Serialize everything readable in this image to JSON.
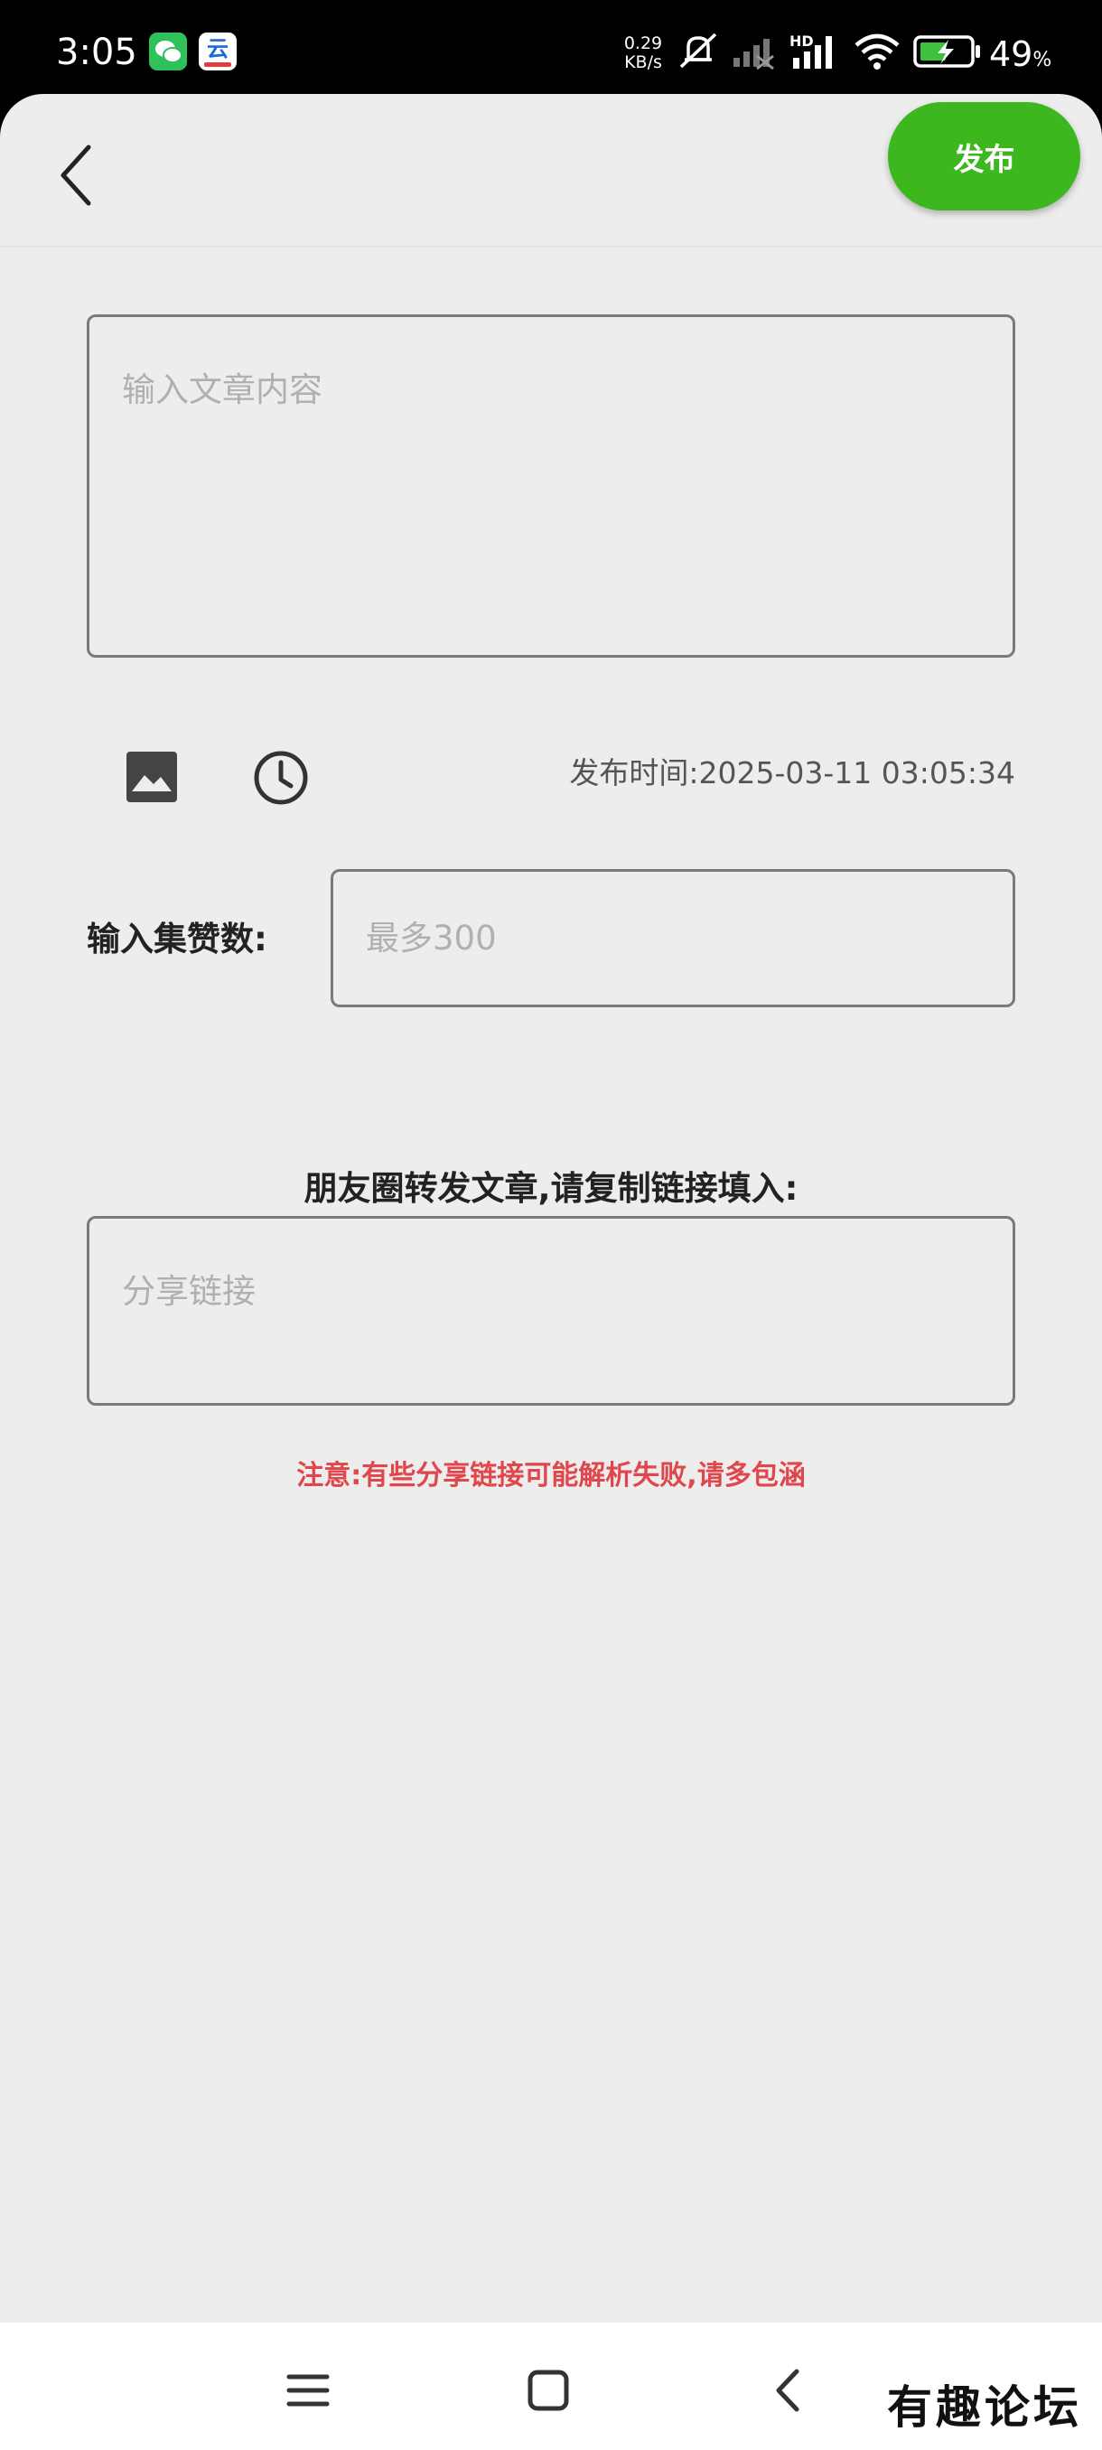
{
  "status_bar": {
    "time": "3:05",
    "net_speed_value": "0.29",
    "net_speed_unit": "KB/s",
    "network_badge": "HD",
    "battery_percent": "49",
    "battery_unit": "%",
    "cloud_app_glyph": "云"
  },
  "header": {
    "publish_label": "发布"
  },
  "form": {
    "content_placeholder": "输入文章内容",
    "publish_time_label": "发布时间:",
    "publish_time_value": "2025-03-11 03:05:34",
    "likes_label": "输入集赞数:",
    "likes_placeholder": "最多300",
    "share_title": "朋友圈转发文章,请复制链接填入:",
    "share_placeholder": "分享链接",
    "notice": "注意:有些分享链接可能解析失败,请多包涵"
  },
  "watermark": "有趣论坛",
  "colors": {
    "accent": "#3db71e",
    "notice": "#e0474c",
    "background": "#ededed"
  }
}
